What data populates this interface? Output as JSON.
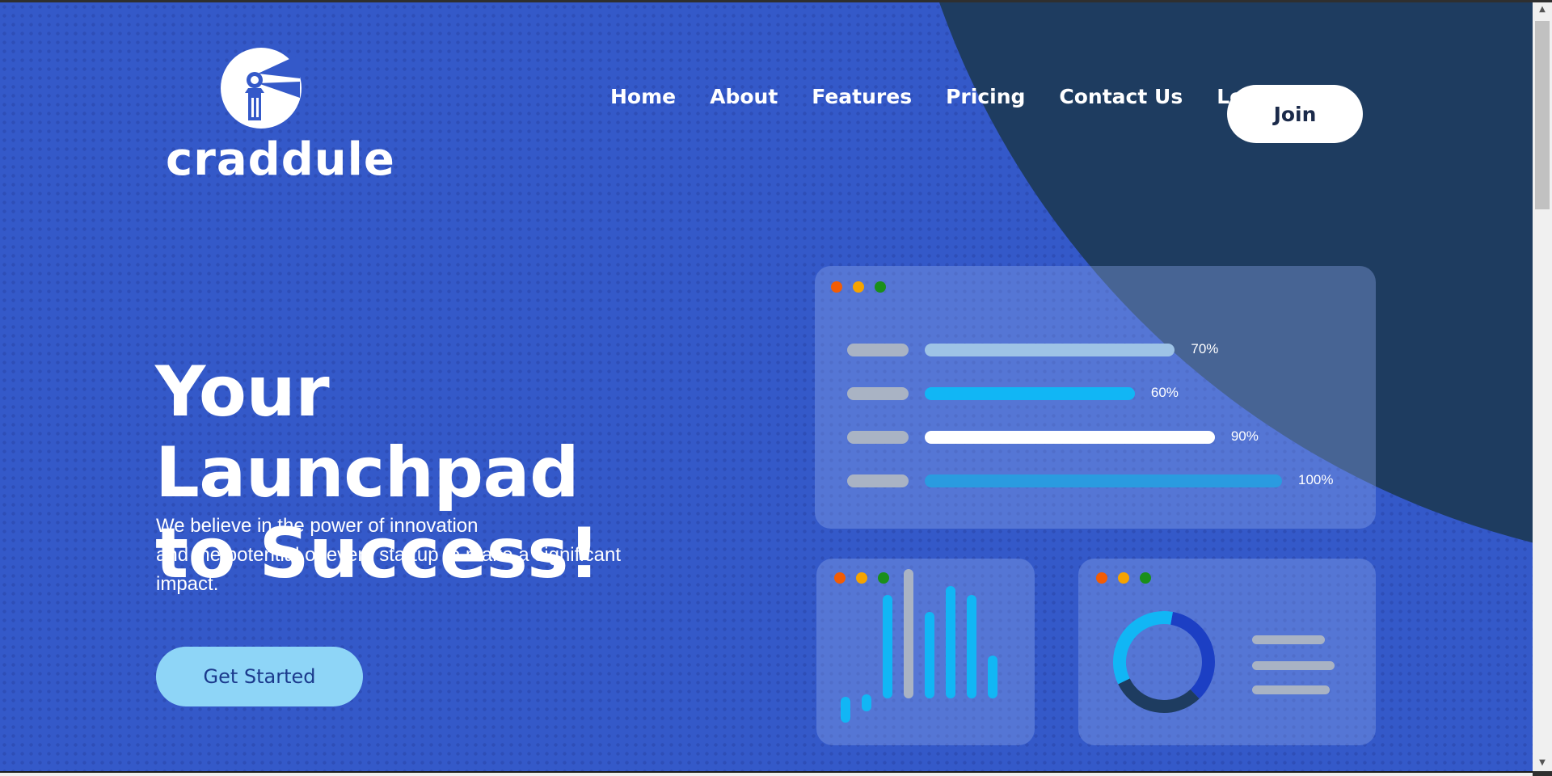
{
  "brand": {
    "name": "craddule"
  },
  "nav": {
    "items": [
      "Home",
      "About",
      "Features",
      "Pricing",
      "Contact Us",
      "Login"
    ],
    "join_label": "Join"
  },
  "hero": {
    "title_line1": "Your Launchpad",
    "title_line2": "to Success!",
    "subtitle_line1": "We believe in the power of innovation",
    "subtitle_line2": "and the potential of every startup to make a significant impact.",
    "cta_label": "Get Started"
  },
  "dashboard": {
    "window_dot_colors": [
      "#f25c05",
      "#f5a300",
      "#1a8f1a"
    ],
    "progress_bars": [
      {
        "percent": 70,
        "label": "70%",
        "color": "#9ec3e6"
      },
      {
        "percent": 60,
        "label": "60%",
        "color": "#11b6f5"
      },
      {
        "percent": 90,
        "label": "90%",
        "color": "#ffffff"
      },
      {
        "percent": 100,
        "label": "100%",
        "color": "#2a9be0"
      }
    ],
    "bar_chart_values": [
      3,
      2,
      12,
      15,
      10,
      13,
      12,
      5
    ],
    "donut_segments": [
      {
        "fraction": 0.35,
        "color": "#1c3fc4"
      },
      {
        "fraction": 0.3,
        "color": "#1e3c60"
      },
      {
        "fraction": 0.35,
        "color": "#11b6f5"
      }
    ]
  },
  "colors": {
    "background": "#3459c9",
    "navy_shape": "#1e3c60",
    "cta_background": "#8ed5f7"
  }
}
